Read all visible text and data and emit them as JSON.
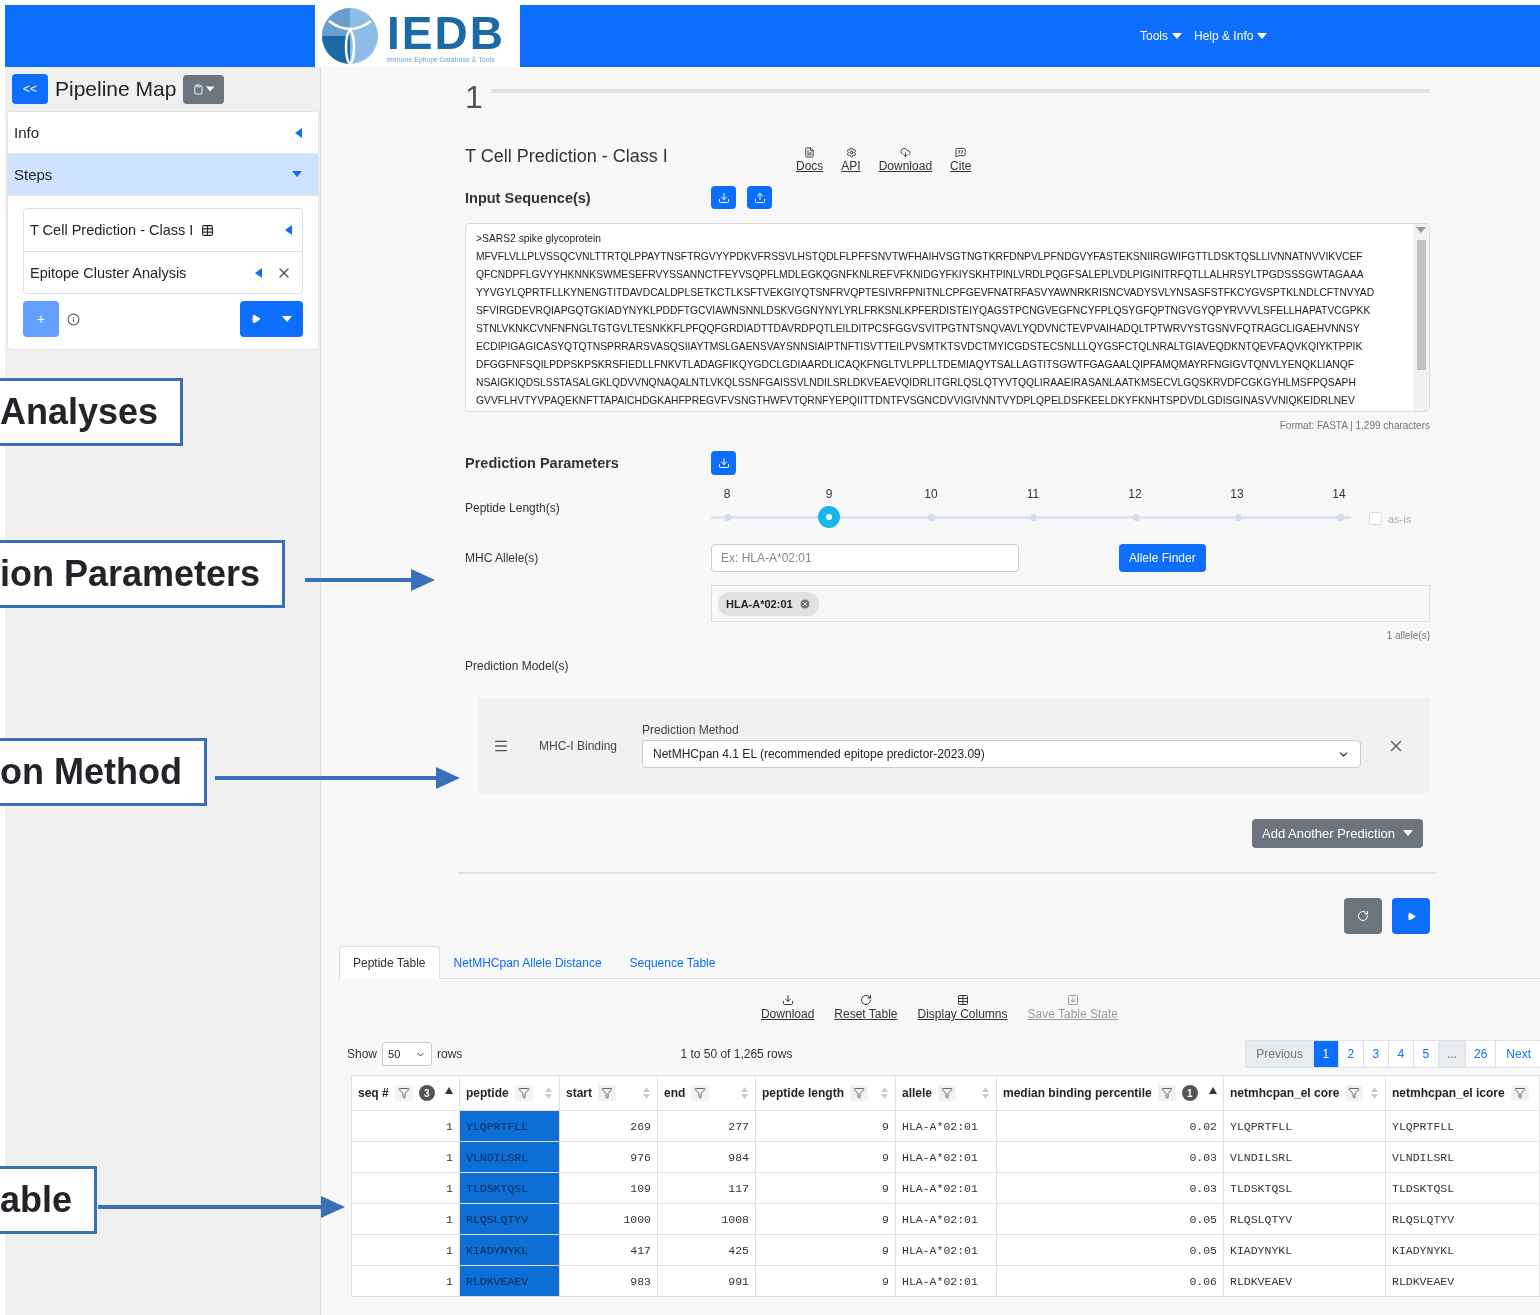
{
  "header": {
    "logo": {
      "name": "IEDB",
      "tagline": "Immune Epitope Database & Tools"
    },
    "nav": [
      {
        "label": "Tools"
      },
      {
        "label": "Help & Info"
      }
    ]
  },
  "sidebar": {
    "collapse_button": "<<",
    "title": "Pipeline Map",
    "sections": [
      {
        "label": "Info",
        "expanded": false
      },
      {
        "label": "Steps",
        "expanded": true
      }
    ],
    "steps": [
      {
        "label": "T Cell Prediction - Class I",
        "kind": "table"
      },
      {
        "label": "Epitope Cluster Analysis",
        "kind": "removable"
      }
    ],
    "add_button": "+"
  },
  "callouts": [
    {
      "text": "Analyses",
      "arrow": false
    },
    {
      "text": "ion Parameters",
      "arrow": true
    },
    {
      "text": "on Method",
      "arrow": true
    },
    {
      "text": "able",
      "arrow": true
    }
  ],
  "step": {
    "number": "1",
    "title": "T Cell Prediction - Class I",
    "links": [
      {
        "label": "Docs",
        "kind": "docs"
      },
      {
        "label": "API",
        "kind": "api"
      },
      {
        "label": "Download",
        "kind": "download"
      },
      {
        "label": "Cite",
        "kind": "cite"
      }
    ]
  },
  "input_sequence": {
    "label": "Input Sequence(s)",
    "header": ">SARS2 spike glycoprotein",
    "lines": [
      "MFVFLVLLPLVSSQCVNLTTRTQLPPAYTNSFTRGVYYPDKVFRSSVLHSTQDLFLPFFSNVTWFHAIHVSGTNGTKRFDNPVLPFNDGVYFASTEKSNIIRGWIFGTTLDSKTQSLLIVNNATNVVIKVCEF",
      "QFCNDPFLGVYYHKNNKSWMESEFRVYSSANNCTFEYVSQPFLMDLEGKQGNFKNLREFVFKNIDGYFKIYSKHTPINLVRDLPQGFSALEPLVDLPIGINITRFQTLLALHRSYLTPGDSSSGWTAGAAA",
      "YYVGYLQPRTFLLKYNENGTITDAVDCALDPLSETKCTLKSFTVEKGIYQTSNFRVQPTESIVRFPNITNLCPFGEVFNATRFASVYAWNRKRISNCVADYSVLYNSASFSTFKCYGVSPTKLNDLCFTNVYAD",
      "SFVIRGDEVRQIAPGQTGKIADYNYKLPDDFTGCVIAWNSNNLDSKVGGNYNYLYRLFRKSNLKPFERDISTEIYQAGSTPCNGVEGFNCYFPLQSYGFQPTNGVGYQPYRVVVLSFELLHAPATVCGPKK",
      "STNLVKNKCVNFNFNGLTGTGVLTESNKKFLPFQQFGRDIADTTDAVRDPQTLEILDITPCSFGGVSVITPGTNTSNQVAVLYQDVNCTEVPVAIHADQLTPTWRVYSTGSNVFQTRAGCLIGAEHVNNSY",
      "ECDIPIGAGICASYQTQTNSPRRARSVASQSIIAYTMSLGAENSVAYSNNSIAIPTNFTISVTTEILPVSMTKTSVDCTMYICGDSTECSNLLLQYGSFCTQLNRALTGIAVEQDKNTQEVFAQVKQIYKTPPIK",
      "DFGGFNFSQILPDPSKPSKRSFIEDLLFNKVTLADAGFIKQYGDCLGDIAARDLICAQKFNGLTVLPPLLTDEMIAQYTSALLAGTITSGWTFGAGAALQIPFAMQMAYRFNGIGVTQNVLYENQKLIANQF",
      "NSAIGKIQDSLSSTASALGKLQDVVNQNAQALNTLVKQLSSNFGAISSVLNDILSRLDKVEAEVQIDRLITGRLQSLQTYVTQQLIRAAEIRASANLAATKMSECVLGQSKRVDFCGKGYHLMSFPQSAPH",
      "GVVFLHVTYVPAQEKNFTTAPAICHDGKAHFPREGVFVSNGTHWFVTQRNFYEPQIITTDNTFVSGNCDVVIGIVNNTVYDPLQPELDSFKEELDKYFKNHTSPDVDLGDISGINASVVNIQKEIDRLNEV"
    ],
    "format_note": "Format: FASTA | 1,299 characters"
  },
  "parameters": {
    "label": "Prediction Parameters",
    "peptide_length": {
      "label": "Peptide Length(s)",
      "ticks": [
        {
          "label": "8",
          "selected": false
        },
        {
          "label": "9",
          "selected": true
        },
        {
          "label": "10",
          "selected": false
        },
        {
          "label": "11",
          "selected": false
        },
        {
          "label": "12",
          "selected": false
        },
        {
          "label": "13",
          "selected": false
        },
        {
          "label": "14",
          "selected": false
        }
      ],
      "as_is": {
        "label": "as-is",
        "checked": false
      }
    },
    "alleles": {
      "label": "MHC Allele(s)",
      "placeholder": "Ex: HLA-A*02:01",
      "finder_button": "Allele Finder",
      "chips": [
        "HLA-A*02:01"
      ],
      "count": "1 allele(s)"
    },
    "models": {
      "label": "Prediction Model(s)",
      "items": [
        {
          "name": "MHC-I Binding",
          "method_label": "Prediction Method",
          "method": "NetMHCpan 4.1 EL (recommended epitope predictor-2023.09)"
        }
      ],
      "add_button": "Add Another Prediction"
    }
  },
  "results": {
    "tabs": [
      {
        "label": "Peptide Table",
        "selected": true
      },
      {
        "label": "NetMHCpan Allele Distance",
        "selected": false
      },
      {
        "label": "Sequence Table",
        "selected": false
      }
    ],
    "toolbar": [
      {
        "label": "Download",
        "kind": "download",
        "disabled": false
      },
      {
        "label": "Reset Table",
        "kind": "reset",
        "disabled": false
      },
      {
        "label": "Display Columns",
        "kind": "columns",
        "disabled": false
      },
      {
        "label": "Save Table State",
        "kind": "save",
        "disabled": true
      }
    ],
    "page_size": {
      "prefix": "Show",
      "value": "50",
      "suffix": "rows"
    },
    "summary": "1 to 50 of 1,265 rows",
    "pagination": [
      {
        "label": "Previous",
        "selected": false,
        "disabled": true
      },
      {
        "label": "1",
        "selected": true,
        "disabled": false
      },
      {
        "label": "2",
        "selected": false,
        "disabled": false
      },
      {
        "label": "3",
        "selected": false,
        "disabled": false
      },
      {
        "label": "4",
        "selected": false,
        "disabled": false
      },
      {
        "label": "5",
        "selected": false,
        "disabled": false
      },
      {
        "label": "...",
        "selected": false,
        "disabled": true
      },
      {
        "label": "26",
        "selected": false,
        "disabled": false
      },
      {
        "label": "Next",
        "selected": false,
        "disabled": false
      }
    ],
    "table": {
      "columns": [
        {
          "label": "seq #",
          "kind": "number",
          "sorted": true,
          "sort_rank": "3",
          "highlight": false
        },
        {
          "label": "peptide",
          "kind": "text",
          "sorted": false,
          "highlight": true
        },
        {
          "label": "start",
          "kind": "number",
          "sorted": false,
          "highlight": false
        },
        {
          "label": "end",
          "kind": "number",
          "sorted": false,
          "highlight": false
        },
        {
          "label": "peptide length",
          "kind": "number",
          "sorted": false,
          "highlight": false
        },
        {
          "label": "allele",
          "kind": "text",
          "sorted": false,
          "highlight": false
        },
        {
          "label": "median binding percentile",
          "kind": "number",
          "sorted": true,
          "sort_rank": "1",
          "highlight": false
        },
        {
          "label": "netmhcpan_el core",
          "kind": "text",
          "sorted": false,
          "highlight": false
        },
        {
          "label": "netmhcpan_el icore",
          "kind": "text",
          "highlight": false
        }
      ],
      "rows": [
        [
          "1",
          "YLQPRTFLL",
          "269",
          "277",
          "9",
          "HLA-A*02:01",
          "0.02",
          "YLQPRTFLL",
          "YLQPRTFLL"
        ],
        [
          "1",
          "VLNDILSRL",
          "976",
          "984",
          "9",
          "HLA-A*02:01",
          "0.03",
          "VLNDILSRL",
          "VLNDILSRL"
        ],
        [
          "1",
          "TLDSKTQSL",
          "109",
          "117",
          "9",
          "HLA-A*02:01",
          "0.03",
          "TLDSKTQSL",
          "TLDSKTQSL"
        ],
        [
          "1",
          "RLQSLQTYV",
          "1000",
          "1008",
          "9",
          "HLA-A*02:01",
          "0.05",
          "RLQSLQTYV",
          "RLQSLQTYV"
        ],
        [
          "1",
          "KIADYNYKL",
          "417",
          "425",
          "9",
          "HLA-A*02:01",
          "0.05",
          "KIADYNYKL",
          "KIADYNYKL"
        ],
        [
          "1",
          "RLDKVEAEV",
          "983",
          "991",
          "9",
          "HLA-A*02:01",
          "0.06",
          "RLDKVEAEV",
          "RLDKVEAEV"
        ]
      ]
    }
  }
}
